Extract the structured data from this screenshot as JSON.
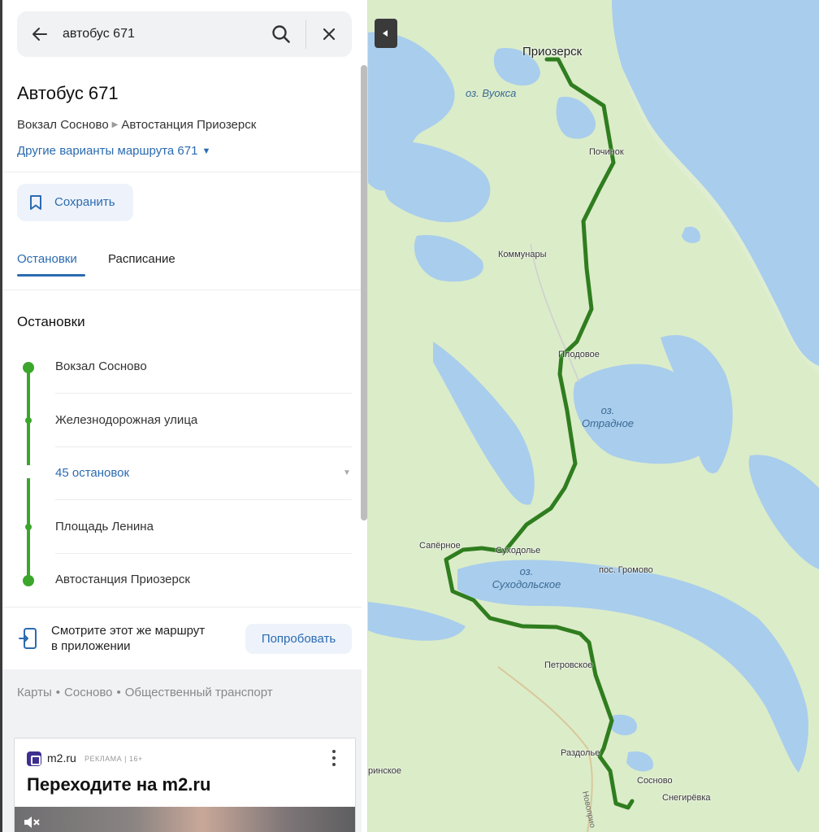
{
  "search": {
    "query": "автобус 671"
  },
  "route": {
    "title": "Автобус 671",
    "from": "Вокзал Сосново",
    "to": "Автостанция Приозерск",
    "variants_link": "Другие варианты маршрута 671"
  },
  "actions": {
    "save_label": "Сохранить"
  },
  "tabs": [
    {
      "label": "Остановки",
      "active": true
    },
    {
      "label": "Расписание",
      "active": false
    }
  ],
  "stops": {
    "heading": "Остановки",
    "items": [
      "Вокзал Сосново",
      "Железнодорожная улица",
      "45 остановок",
      "Площадь Ленина",
      "Автостанция Приозерск"
    ]
  },
  "app_promo": {
    "line1": "Смотрите этот же маршрут",
    "line2": "в приложении",
    "button": "Попробовать"
  },
  "breadcrumbs": [
    "Карты",
    "Сосново",
    "Общественный транспорт"
  ],
  "ad": {
    "brand": "m2.ru",
    "label": "РЕКЛАМА",
    "age": "16+",
    "headline": "Переходите на m2.ru"
  },
  "map": {
    "places": {
      "priozersk": "Приозерск",
      "pochinok": "Починок",
      "kommunary": "Коммунары",
      "plodovoe": "Плодовое",
      "saperное": "Сапёрное",
      "sukhodolye": "Суходолье",
      "gromovo": "пос. Громово",
      "petrovskoe": "Петровское",
      "razdolye": "Раздолье",
      "sosnovo": "Сосново",
      "snegirevka": "Снегирёвка",
      "rinskoe": "ринское",
      "road": "Новоприо"
    },
    "lakes": {
      "vuoksa": "оз. Вуокса",
      "otradnoe_1": "оз.",
      "otradnoe_2": "Отрадное",
      "sukhodolskoe_1": "оз.",
      "sukhodolskoe_2": "Суходольское"
    }
  },
  "colors": {
    "accent": "#2b6bb0",
    "route": "#3ba62b",
    "map_route": "#2f7d1f",
    "water": "#a9cdec",
    "land": "#dfeed0"
  }
}
